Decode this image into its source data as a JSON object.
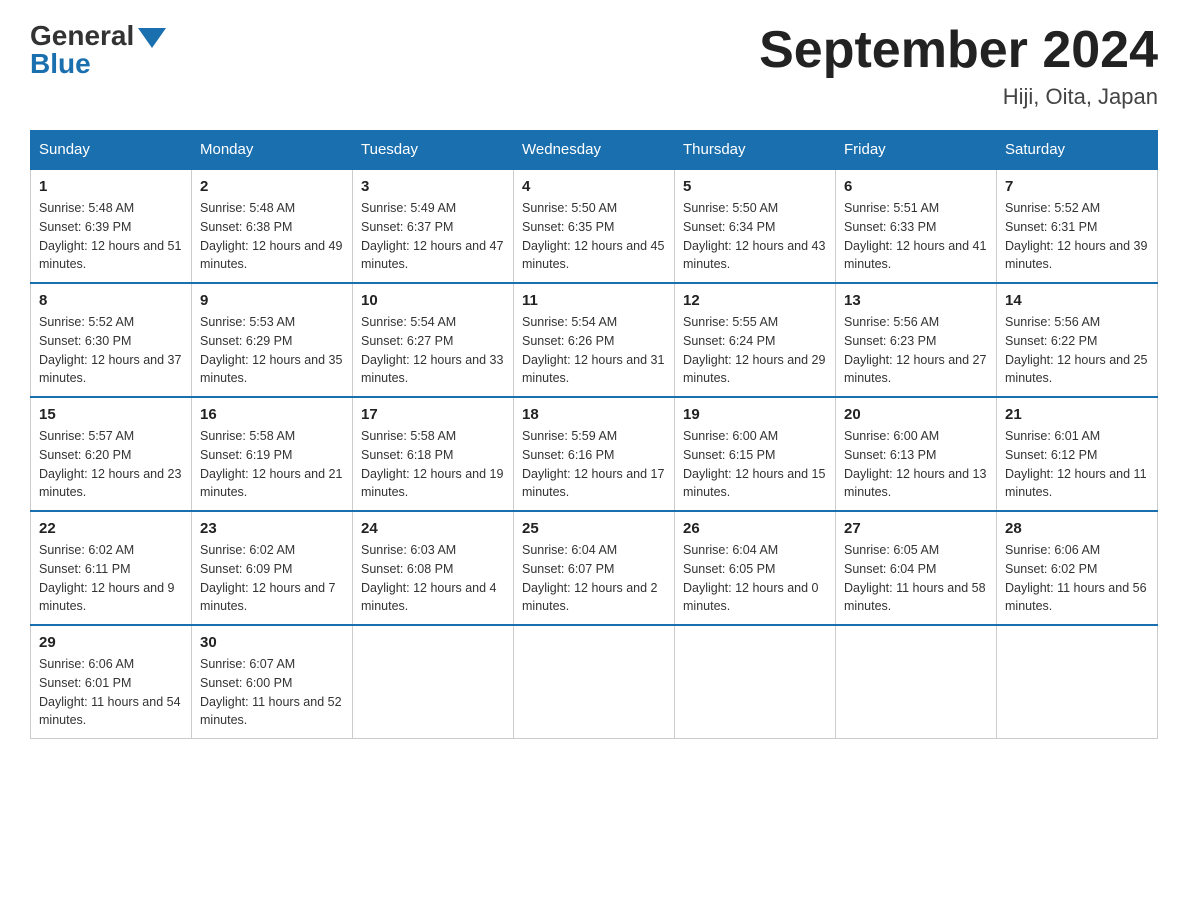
{
  "logo": {
    "general": "General",
    "blue": "Blue"
  },
  "header": {
    "month": "September 2024",
    "location": "Hiji, Oita, Japan"
  },
  "weekdays": [
    "Sunday",
    "Monday",
    "Tuesday",
    "Wednesday",
    "Thursday",
    "Friday",
    "Saturday"
  ],
  "weeks": [
    [
      {
        "day": "1",
        "sunrise": "5:48 AM",
        "sunset": "6:39 PM",
        "daylight": "12 hours and 51 minutes."
      },
      {
        "day": "2",
        "sunrise": "5:48 AM",
        "sunset": "6:38 PM",
        "daylight": "12 hours and 49 minutes."
      },
      {
        "day": "3",
        "sunrise": "5:49 AM",
        "sunset": "6:37 PM",
        "daylight": "12 hours and 47 minutes."
      },
      {
        "day": "4",
        "sunrise": "5:50 AM",
        "sunset": "6:35 PM",
        "daylight": "12 hours and 45 minutes."
      },
      {
        "day": "5",
        "sunrise": "5:50 AM",
        "sunset": "6:34 PM",
        "daylight": "12 hours and 43 minutes."
      },
      {
        "day": "6",
        "sunrise": "5:51 AM",
        "sunset": "6:33 PM",
        "daylight": "12 hours and 41 minutes."
      },
      {
        "day": "7",
        "sunrise": "5:52 AM",
        "sunset": "6:31 PM",
        "daylight": "12 hours and 39 minutes."
      }
    ],
    [
      {
        "day": "8",
        "sunrise": "5:52 AM",
        "sunset": "6:30 PM",
        "daylight": "12 hours and 37 minutes."
      },
      {
        "day": "9",
        "sunrise": "5:53 AM",
        "sunset": "6:29 PM",
        "daylight": "12 hours and 35 minutes."
      },
      {
        "day": "10",
        "sunrise": "5:54 AM",
        "sunset": "6:27 PM",
        "daylight": "12 hours and 33 minutes."
      },
      {
        "day": "11",
        "sunrise": "5:54 AM",
        "sunset": "6:26 PM",
        "daylight": "12 hours and 31 minutes."
      },
      {
        "day": "12",
        "sunrise": "5:55 AM",
        "sunset": "6:24 PM",
        "daylight": "12 hours and 29 minutes."
      },
      {
        "day": "13",
        "sunrise": "5:56 AM",
        "sunset": "6:23 PM",
        "daylight": "12 hours and 27 minutes."
      },
      {
        "day": "14",
        "sunrise": "5:56 AM",
        "sunset": "6:22 PM",
        "daylight": "12 hours and 25 minutes."
      }
    ],
    [
      {
        "day": "15",
        "sunrise": "5:57 AM",
        "sunset": "6:20 PM",
        "daylight": "12 hours and 23 minutes."
      },
      {
        "day": "16",
        "sunrise": "5:58 AM",
        "sunset": "6:19 PM",
        "daylight": "12 hours and 21 minutes."
      },
      {
        "day": "17",
        "sunrise": "5:58 AM",
        "sunset": "6:18 PM",
        "daylight": "12 hours and 19 minutes."
      },
      {
        "day": "18",
        "sunrise": "5:59 AM",
        "sunset": "6:16 PM",
        "daylight": "12 hours and 17 minutes."
      },
      {
        "day": "19",
        "sunrise": "6:00 AM",
        "sunset": "6:15 PM",
        "daylight": "12 hours and 15 minutes."
      },
      {
        "day": "20",
        "sunrise": "6:00 AM",
        "sunset": "6:13 PM",
        "daylight": "12 hours and 13 minutes."
      },
      {
        "day": "21",
        "sunrise": "6:01 AM",
        "sunset": "6:12 PM",
        "daylight": "12 hours and 11 minutes."
      }
    ],
    [
      {
        "day": "22",
        "sunrise": "6:02 AM",
        "sunset": "6:11 PM",
        "daylight": "12 hours and 9 minutes."
      },
      {
        "day": "23",
        "sunrise": "6:02 AM",
        "sunset": "6:09 PM",
        "daylight": "12 hours and 7 minutes."
      },
      {
        "day": "24",
        "sunrise": "6:03 AM",
        "sunset": "6:08 PM",
        "daylight": "12 hours and 4 minutes."
      },
      {
        "day": "25",
        "sunrise": "6:04 AM",
        "sunset": "6:07 PM",
        "daylight": "12 hours and 2 minutes."
      },
      {
        "day": "26",
        "sunrise": "6:04 AM",
        "sunset": "6:05 PM",
        "daylight": "12 hours and 0 minutes."
      },
      {
        "day": "27",
        "sunrise": "6:05 AM",
        "sunset": "6:04 PM",
        "daylight": "11 hours and 58 minutes."
      },
      {
        "day": "28",
        "sunrise": "6:06 AM",
        "sunset": "6:02 PM",
        "daylight": "11 hours and 56 minutes."
      }
    ],
    [
      {
        "day": "29",
        "sunrise": "6:06 AM",
        "sunset": "6:01 PM",
        "daylight": "11 hours and 54 minutes."
      },
      {
        "day": "30",
        "sunrise": "6:07 AM",
        "sunset": "6:00 PM",
        "daylight": "11 hours and 52 minutes."
      },
      null,
      null,
      null,
      null,
      null
    ]
  ]
}
